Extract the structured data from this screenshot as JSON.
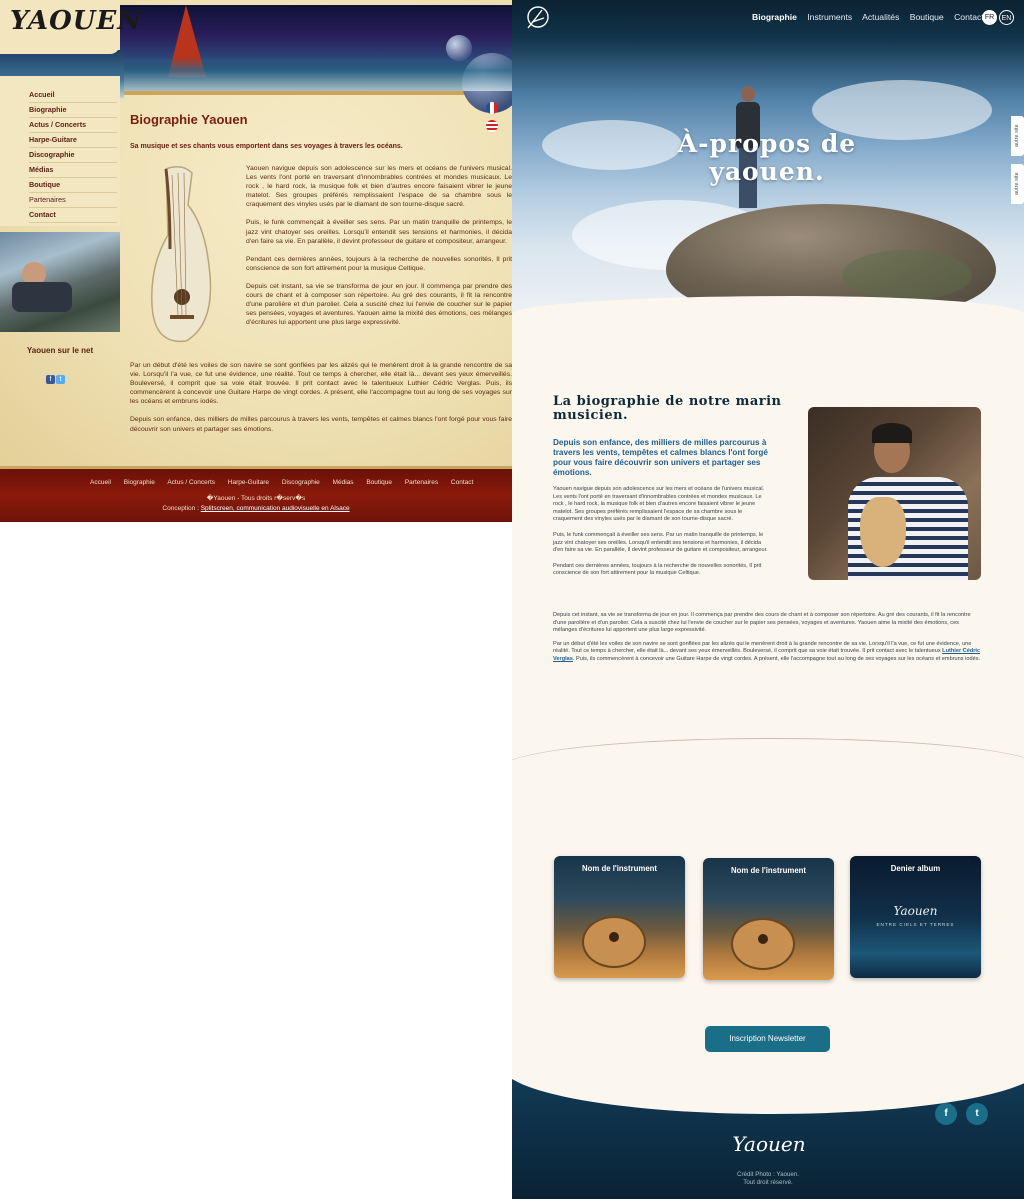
{
  "old_site": {
    "logo": "YAOUEN",
    "nav": [
      "Accueil",
      "Biographie",
      "Actus / Concerts",
      "Harpe-Guitare",
      "Discographie",
      "Médias",
      "Boutique",
      "Partenaires",
      "Contact"
    ],
    "net_title": "Yaouen sur le net",
    "social": [
      "f",
      "t"
    ],
    "title": "Biographie Yaouen",
    "subtitle": "Sa musique et ses chants vous emportent dans ses voyages à travers les océans.",
    "col_paragraphs": [
      "Yaouen navigue depuis son adolescence sur les mers et océans de l'univers musical. Les vents l'ont porté en traversant d'innombrables contrées et mondes musicaux. Le rock , le hard rock, la musique folk et bien d'autres encore faisaient vibrer le jeune matelot. Ses groupes préférés remplissaient l'espace de sa chambre sous le craquement des vinyles usés par le diamant de son tourne-disque sacré.",
      "Puis, le funk commençait à éveiller ses sens. Par un matin tranquille de printemps, le jazz vint chatoyer ses oreilles. Lorsqu'il entendit ses tensions et harmonies, il décida d'en faire sa vie. En parallèle, il devint professeur de guitare et compositeur, arrangeur.",
      "Pendant ces dernières années, toujours à la recherche de nouvelles sonorités, Il prit conscience de son fort attirement pour la musique Celtique.",
      "Depuis cet instant, sa vie se transforma de jour en jour. Il commença par prendre des cours de chant et à composer son répertoire. Au gré des courants, il fit la rencontre d'une parolière et d'un parolier. Cela a suscité chez lui l'envie de coucher sur le papier ses pensées, voyages et aventures. Yaouen aime la mixité des émotions, ces mélanges d'écritures lui apportent une plus large expressivité."
    ],
    "full_paragraphs": [
      "Par un début d'été les voiles de son navire se sont gonflées par les alizés qui le menèrent droit à la grande rencontre de sa vie. Lorsqu'il l'a vue, ce fut une évidence, une réalité. Tout ce temps à chercher, elle était là... devant ses yeux émerveillés. Bouleversé, il comprit que sa voie était trouvée. Il prit contact avec le talentueux Luthier Cédric Verglas. Puis, ils commencèrent à concevoir une Guitare Harpe de vingt cordes. A présent, elle l'accompagne tout au long de ses voyages sur les océans et embruns iodés.",
      "Depuis son enfance, des milliers de milles parcourus à travers les vents, tempêtes et calmes blancs l'ont forgé pour vous faire découvrir son univers et partager ses émotions."
    ],
    "footer_nav": [
      "Accueil",
      "Biographie",
      "Actus / Concerts",
      "Harpe-Guitare",
      "Discographie",
      "Médias",
      "Boutique",
      "Partenaires",
      "Contact"
    ],
    "rights": "�Yaouen - Tous droits r�serv�s",
    "concept_label": "Conception :",
    "concept_link": "Splitscreen, communication audiovisuelle en Alsace"
  },
  "new_site": {
    "menu": [
      "Biographie",
      "Instruments",
      "Actualités",
      "Boutique",
      "Contact"
    ],
    "lang": [
      "FR",
      "EN"
    ],
    "side_tabs": [
      "autre site",
      "autre site"
    ],
    "hero_title": "À-propos de yaouen.",
    "section_title": "La biographie de notre marin musicien.",
    "lead": "Depuis son enfance, des milliers de milles parcourus à travers les vents, tempêtes et calmes blancs l'ont forgé pour vous faire découvrir son univers et partager ses émotions.",
    "text1": [
      "Yaouen navigue depuis son adolescence sur les mers et océans de l'univers musical. Les vents l'ont porté en traversant d'innombrables contrées et mondes musicaux. Le rock , le hard rock, la musique folk et bien d'autres encore faisaient vibrer le jeune matelot. Ses groupes préférés remplissaient l'espace de sa chambre sous le craquement des vinyles usés par le diamant de son tourne-disque sacré.",
      "Puis, le funk commençait à éveiller ses sens. Par un matin tranquille de printemps, le jazz vint chatoyer ses oreilles. Lorsqu'il entendit ses tensions et harmonies, il décida d'en faire sa vie. En parallèle, il devint professeur de guitare et compositeur, arrangeur.",
      "Pendant ces dernières années, toujours à la recherche de nouvelles sonorités, Il prit conscience de son fort attirement pour la musique Celtique."
    ],
    "text2_p1": "Depuis cet instant, sa vie se transforma de jour en jour. Il commença par prendre des cours de chant et à composer son répertoire. Au gré des courants, il fit la rencontre d'une parolière et d'un parolier. Cela a suscité chez lui l'envie de coucher sur le papier ses pensées, voyages et aventures. Yaouen aime la mixité des émotions, ces mélanges d'écritures lui apportent une plus large expressivité.",
    "text2_p2_before": "Par un début d'été les voiles de son navire se sont gonflées par les alizés qui le menèrent droit à la grande rencontre de sa vie. Lorsqu'il l'a vue, ce fut une évidence, une réalité. Tout ce temps à chercher, elle était là... devant ses yeux émerveillés. Bouleversé, il comprit que sa voie était trouvée. Il prit contact avec le talentueux ",
    "text2_link": "Luthier Cédric Verglas",
    "text2_p2_after": ". Puis, ils commencèrent à concevoir une Guitare Harpe de vingt cordes. A présent, elle l'accompagne tout au long de ses voyages sur les océans et embruns iodés.",
    "cards": [
      "Nom de l'instrument",
      "Nom de l'instrument",
      "Denier album"
    ],
    "album_logo": "Yaouen",
    "album_sub": "ENTRE CIELS ET TERRES",
    "newsletter": "Inscription Newsletter",
    "social": [
      "f",
      "t"
    ],
    "footer_logo": "Yaouen",
    "credit": [
      "Crédit Photo : Yaouen.",
      "Tout droit réservé."
    ]
  }
}
